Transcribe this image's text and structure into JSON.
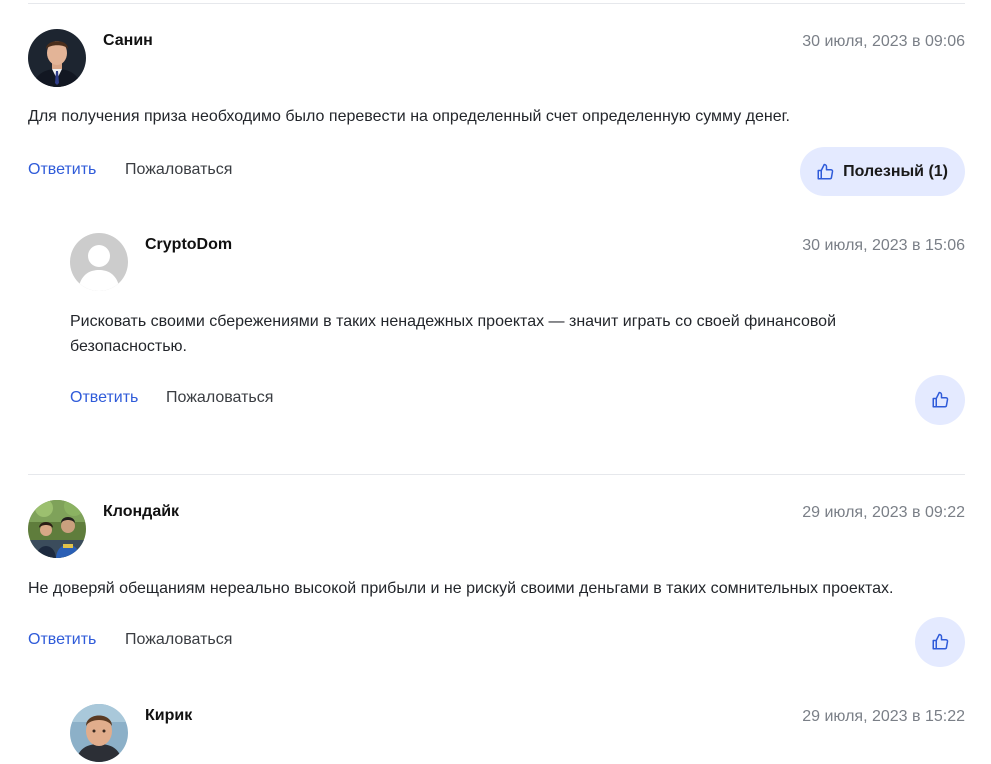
{
  "comments": [
    {
      "author": "Санин",
      "date": "30 июля, 2023 в 09:06",
      "text": "Для получения приза необходимо было перевести на определенный счет определенную сумму денег.",
      "reply_label": "Ответить",
      "report_label": "Пожаловаться",
      "useful_label": "Полезный (1)"
    },
    {
      "author": "CryptoDom",
      "date": "30 июля, 2023 в 15:06",
      "text": "Рисковать своими сбережениями в таких ненадежных проектах — значит играть со своей финансовой безопасностью.",
      "reply_label": "Ответить",
      "report_label": "Пожаловаться"
    },
    {
      "author": "Клондайк",
      "date": "29 июля, 2023 в 09:22",
      "text": "Не доверяй обещаниям нереально высокой прибыли и не рискуй своими деньгами в таких сомнительных проектах.",
      "reply_label": "Ответить",
      "report_label": "Пожаловаться"
    },
    {
      "author": "Кирик",
      "date": "29 июля, 2023 в 15:22"
    }
  ],
  "colors": {
    "link": "#2f5bd9",
    "useful_button_bg": "#e4eaff",
    "date_text": "#7a7f87",
    "divider": "#e6e8ec"
  },
  "icons": {
    "useful": "thumbs-up-icon",
    "default_avatar": "user-silhouette-icon"
  }
}
